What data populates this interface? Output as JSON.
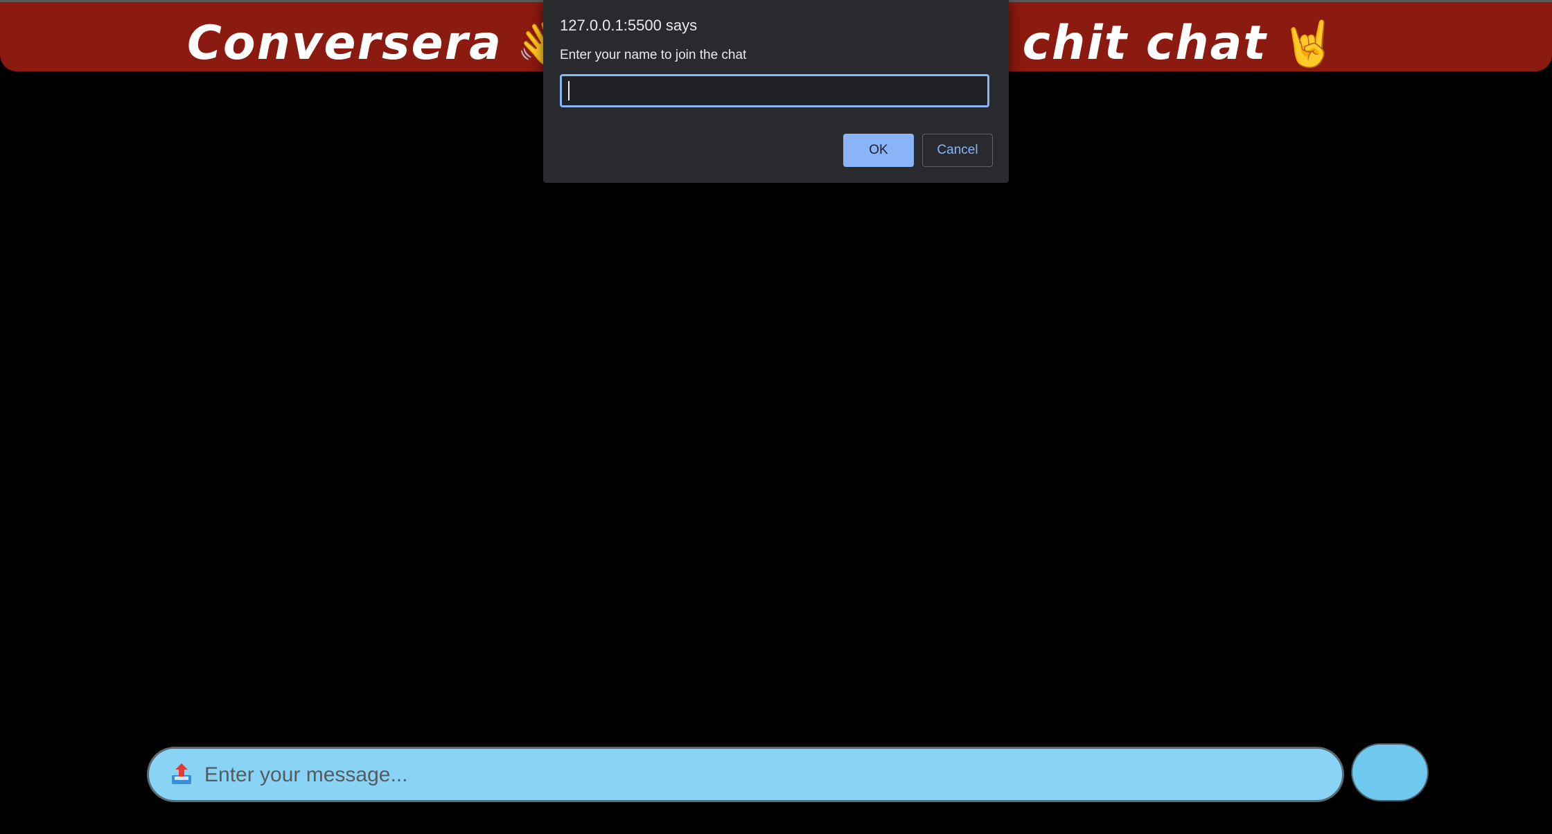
{
  "header": {
    "title_left": "Conversera",
    "wave_emoji": "👋",
    "title_right": "to chit chat",
    "rock_emoji": "🤘",
    "background_color": "#8b1a10"
  },
  "dialog": {
    "title": "127.0.0.1:5500 says",
    "message": "Enter your name to join the chat",
    "input_value": "",
    "ok_label": "OK",
    "cancel_label": "Cancel",
    "accent_color": "#8ab4f8"
  },
  "composer": {
    "placeholder": "Enter your message...",
    "attach_icon": "upload-tray-icon",
    "send_button_label": "",
    "background_color": "#89d4f4"
  }
}
